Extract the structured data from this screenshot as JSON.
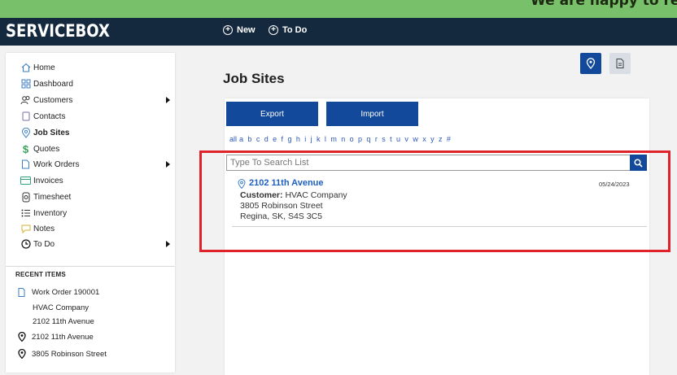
{
  "banner": {
    "text": "We are happy to release"
  },
  "header": {
    "logo": "SERVICEBOX",
    "nav": [
      {
        "label": "New",
        "icon": "plus-circle-icon"
      },
      {
        "label": "To Do",
        "icon": "plus-circle-icon"
      }
    ]
  },
  "sidebar": {
    "items": [
      {
        "label": "Home",
        "icon": "home-icon"
      },
      {
        "label": "Dashboard",
        "icon": "dashboard-icon"
      },
      {
        "label": "Customers",
        "icon": "users-icon",
        "has_submenu": true
      },
      {
        "label": "Contacts",
        "icon": "contact-book-icon"
      },
      {
        "label": "Job Sites",
        "icon": "map-pin-icon",
        "active": true
      },
      {
        "label": "Quotes",
        "icon": "dollar-icon"
      },
      {
        "label": "Work Orders",
        "icon": "document-icon",
        "has_submenu": true
      },
      {
        "label": "Invoices",
        "icon": "credit-card-icon"
      },
      {
        "label": "Timesheet",
        "icon": "stopwatch-icon"
      },
      {
        "label": "Inventory",
        "icon": "list-icon"
      },
      {
        "label": "Notes",
        "icon": "note-icon"
      },
      {
        "label": "To Do",
        "icon": "clock-icon",
        "has_submenu": true
      }
    ]
  },
  "recent": {
    "title": "RECENT ITEMS",
    "work_order": "Work Order 190001",
    "work_order_customer": "HVAC Company",
    "work_order_site": "2102 11th Avenue",
    "job_site": "2102 11th Avenue",
    "address": "3805 Robinson Street"
  },
  "main": {
    "title": "Job Sites",
    "export_label": "Export",
    "import_label": "Import",
    "alphabet": [
      "all",
      "a",
      "b",
      "c",
      "d",
      "e",
      "f",
      "g",
      "h",
      "i",
      "j",
      "k",
      "l",
      "m",
      "n",
      "o",
      "p",
      "q",
      "r",
      "s",
      "t",
      "u",
      "v",
      "w",
      "x",
      "y",
      "z",
      "#"
    ],
    "search_placeholder": "Type To Search List",
    "result": {
      "title": "2102 11th Avenue",
      "date": "05/24/2023",
      "customer_label": "Customer:",
      "customer": "HVAC Company",
      "street": "3805 Robinson Street",
      "city": "Regina, SK, S4S 3C5"
    }
  },
  "colors": {
    "banner": "#78c06a",
    "topbar": "#15293e",
    "primary": "#13499a",
    "link": "#1e5fbf",
    "highlight": "#e0222b"
  }
}
